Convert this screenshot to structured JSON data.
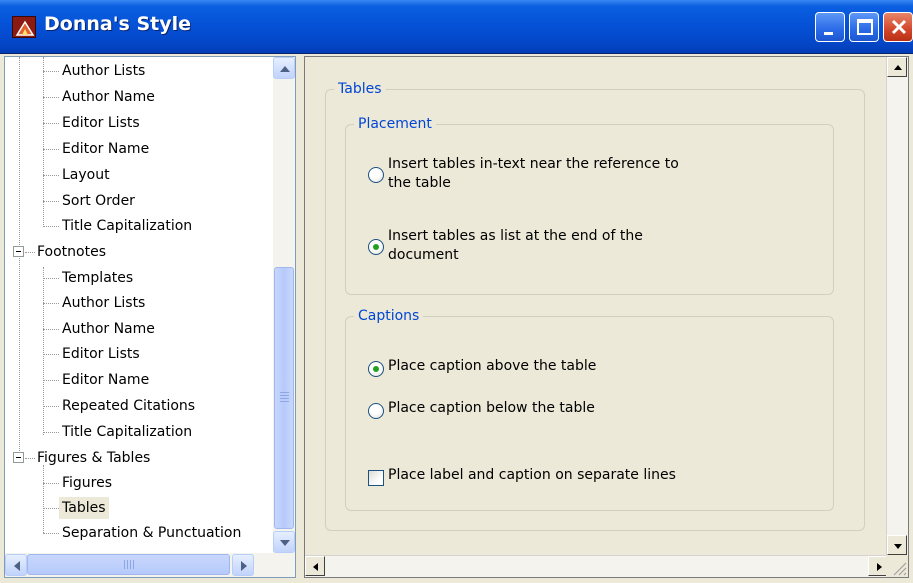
{
  "window": {
    "title": "Donna's Style"
  },
  "tree": {
    "items": [
      {
        "label": "Author Lists",
        "level": 2
      },
      {
        "label": "Author Name",
        "level": 2
      },
      {
        "label": "Editor Lists",
        "level": 2
      },
      {
        "label": "Editor Name",
        "level": 2
      },
      {
        "label": "Layout",
        "level": 2
      },
      {
        "label": "Sort Order",
        "level": 2
      },
      {
        "label": "Title Capitalization",
        "level": 2
      },
      {
        "label": "Footnotes",
        "level": 1,
        "expanded": true
      },
      {
        "label": "Templates",
        "level": 2
      },
      {
        "label": "Author Lists",
        "level": 2
      },
      {
        "label": "Author Name",
        "level": 2
      },
      {
        "label": "Editor Lists",
        "level": 2
      },
      {
        "label": "Editor Name",
        "level": 2
      },
      {
        "label": "Repeated Citations",
        "level": 2
      },
      {
        "label": "Title Capitalization",
        "level": 2
      },
      {
        "label": "Figures & Tables",
        "level": 1,
        "expanded": true
      },
      {
        "label": "Figures",
        "level": 2
      },
      {
        "label": "Tables",
        "level": 2,
        "selected": true
      },
      {
        "label": "Separation & Punctuation",
        "level": 2
      }
    ]
  },
  "panel": {
    "title": "Tables",
    "placement": {
      "title": "Placement",
      "options": [
        {
          "label": "Insert tables in-text near the reference to",
          "label2": "the table",
          "checked": false
        },
        {
          "label": "Insert tables as list at the end of the",
          "label2": "document",
          "checked": true
        }
      ]
    },
    "captions": {
      "title": "Captions",
      "options": [
        {
          "label": "Place caption above the table",
          "checked": true
        },
        {
          "label": "Place caption below the table",
          "checked": false
        }
      ],
      "checkbox": {
        "label": "Place label and caption on separate lines",
        "checked": false
      }
    }
  },
  "colors": {
    "title_bar": "#0552d8",
    "legend_text": "#0046d5",
    "radio_dot": "#21a121",
    "window_bg": "#ECE9D8"
  }
}
